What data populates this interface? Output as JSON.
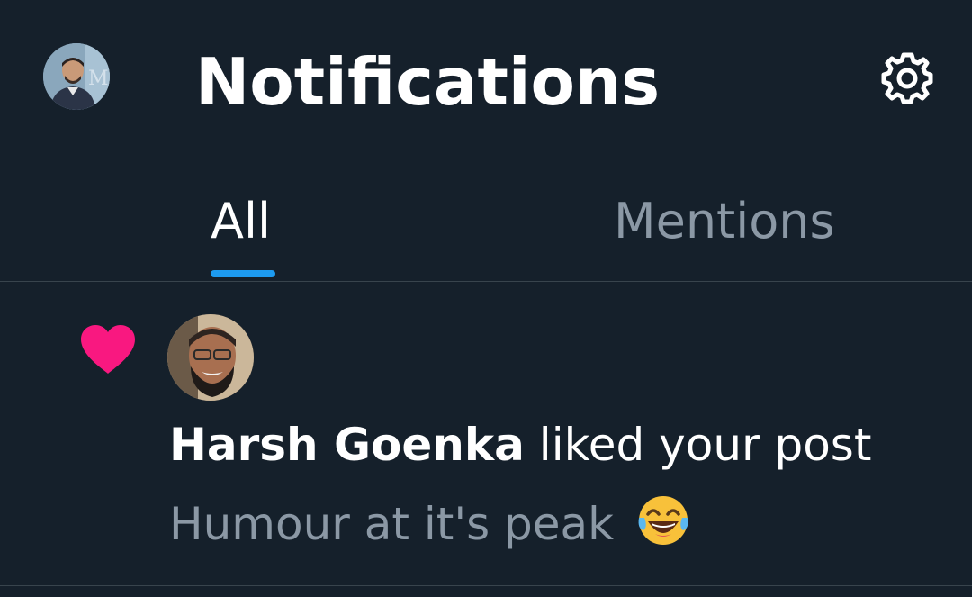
{
  "header": {
    "title": "Notifications",
    "avatar_icon": "user-avatar-icon",
    "settings_icon": "gear-icon"
  },
  "tabs": [
    {
      "label": "All",
      "selected": true
    },
    {
      "label": "Mentions",
      "selected": false
    }
  ],
  "notifications": [
    {
      "type_icon": "heart-icon",
      "user_name": "Harsh Goenka",
      "action": " liked your post",
      "post_text": "Humour at it's peak",
      "post_emoji": "face-with-tears-of-joy-emoji"
    }
  ],
  "colors": {
    "background": "#15202b",
    "text_primary": "#ffffff",
    "text_secondary": "#8b98a5",
    "accent": "#1d9bf0",
    "like": "#f91880",
    "divider": "#38444d"
  }
}
